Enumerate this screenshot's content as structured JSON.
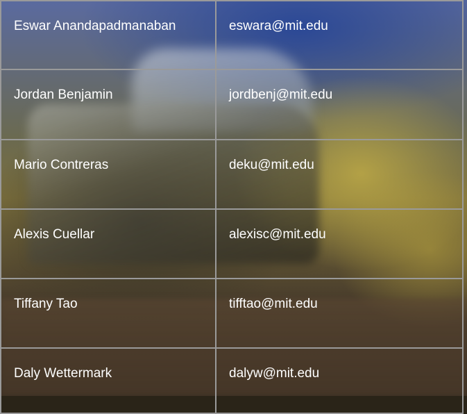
{
  "roster": {
    "rows": [
      {
        "name": "Eswar Anandapadmanaban",
        "email": "eswara@mit.edu"
      },
      {
        "name": "Jordan Benjamin",
        "email": "jordbenj@mit.edu"
      },
      {
        "name": "Mario Contreras",
        "email": "deku@mit.edu"
      },
      {
        "name": "Alexis Cuellar",
        "email": "alexisc@mit.edu"
      },
      {
        "name": "Tiffany Tao",
        "email": "tifftao@mit.edu"
      },
      {
        "name": "Daly Wettermark",
        "email": "dalyw@mit.edu"
      }
    ]
  },
  "background": {
    "image": "blurred-combine-harvester-photo",
    "text_color": "#ffffff",
    "border_color": "#9a9a9a"
  }
}
